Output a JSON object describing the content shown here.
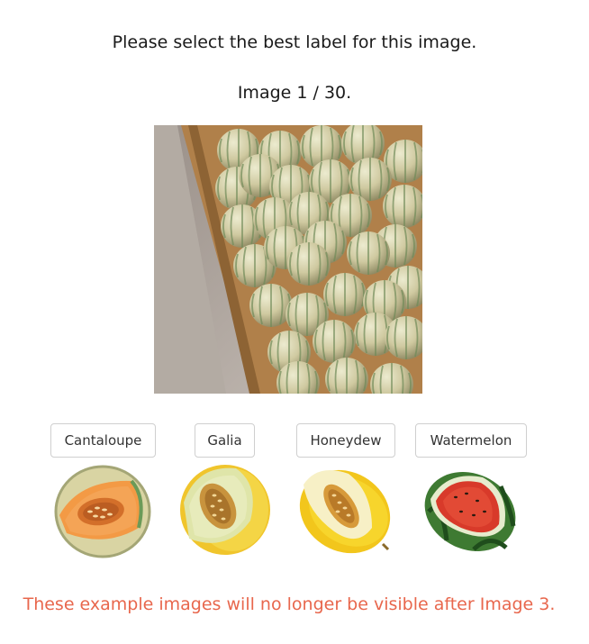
{
  "prompt": {
    "instruction": "Please select the best label for this image.",
    "counter": "Image 1 / 30."
  },
  "target_image": {
    "subject": "pile of cantaloupe melons in a wooden crate"
  },
  "labels": [
    {
      "label": "Cantaloupe",
      "example": "cut cantaloupe melon"
    },
    {
      "label": "Galia",
      "example": "cut galia melon"
    },
    {
      "label": "Honeydew",
      "example": "cut honeydew melon"
    },
    {
      "label": "Watermelon",
      "example": "cut watermelon"
    }
  ],
  "notice": {
    "text": "These example images will no longer be visible after Image 3.",
    "color": "#e8674d"
  }
}
